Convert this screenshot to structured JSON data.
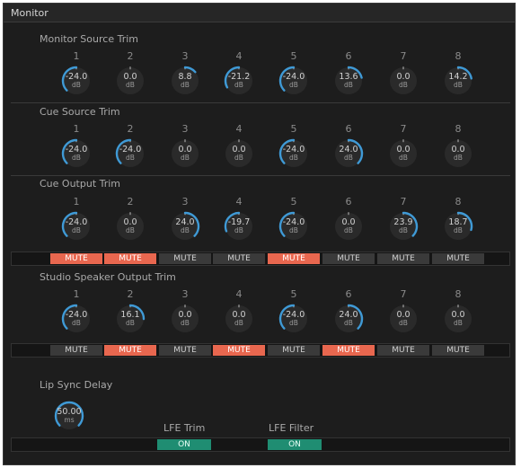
{
  "panel": {
    "title": "Monitor"
  },
  "monitor_source_trim": {
    "title": "Monitor Source Trim",
    "channels": [
      "1",
      "2",
      "3",
      "4",
      "5",
      "6",
      "7",
      "8"
    ],
    "values": [
      "-24.0",
      "0.0",
      "8.8",
      "-21.2",
      "-24.0",
      "13.6",
      "0.0",
      "14.2"
    ],
    "unit": "dB",
    "levels": [
      -24,
      0,
      8.8,
      -21.2,
      -24,
      13.6,
      0,
      14.2
    ]
  },
  "cue_source_trim": {
    "title": "Cue Source Trim",
    "channels": [
      "1",
      "2",
      "3",
      "4",
      "5",
      "6",
      "7",
      "8"
    ],
    "values": [
      "-24.0",
      "-24.0",
      "0.0",
      "0.0",
      "-24.0",
      "24.0",
      "0.0",
      "0.0"
    ],
    "unit": "dB",
    "levels": [
      -24,
      -24,
      0,
      0,
      -24,
      24,
      0,
      0
    ]
  },
  "cue_output_trim": {
    "title": "",
    "channels": [
      "1",
      "2",
      "3",
      "4",
      "5",
      "6",
      "7",
      "8"
    ],
    "values": [
      "-24.0",
      "0.0",
      "24.0",
      "-19.7",
      "-24.0",
      "0.0",
      "23.9",
      "18.7"
    ],
    "unit": "dB",
    "levels": [
      -24,
      0,
      24,
      -19.7,
      -24,
      0,
      23.9,
      18.7
    ],
    "mute_label": "MUTE",
    "mute_states": [
      true,
      true,
      false,
      false,
      true,
      false,
      false,
      false
    ]
  },
  "cue_output_title": "Cue Output Trim",
  "studio_speaker_output_trim": {
    "title": "Studio Speaker Output Trim",
    "channels": [
      "1",
      "2",
      "3",
      "4",
      "5",
      "6",
      "7",
      "8"
    ],
    "values": [
      "-24.0",
      "16.1",
      "0.0",
      "0.0",
      "-24.0",
      "24.0",
      "0.0",
      "0.0"
    ],
    "unit": "dB",
    "levels": [
      -24,
      16.1,
      0,
      0,
      -24,
      24,
      0,
      0
    ],
    "mute_label": "MUTE",
    "mute_states": [
      false,
      true,
      false,
      true,
      false,
      true,
      false,
      false
    ]
  },
  "lip_sync_delay": {
    "title": "Lip Sync Delay",
    "value": "50.00",
    "unit": "ms"
  },
  "lfe_trim": {
    "label": "LFE Trim",
    "button": "ON"
  },
  "lfe_filter": {
    "label": "LFE Filter",
    "button": "ON"
  },
  "colors": {
    "arc": "#3f9ad6",
    "mute_on": "#e8674f",
    "on_button": "#1f8d72"
  }
}
